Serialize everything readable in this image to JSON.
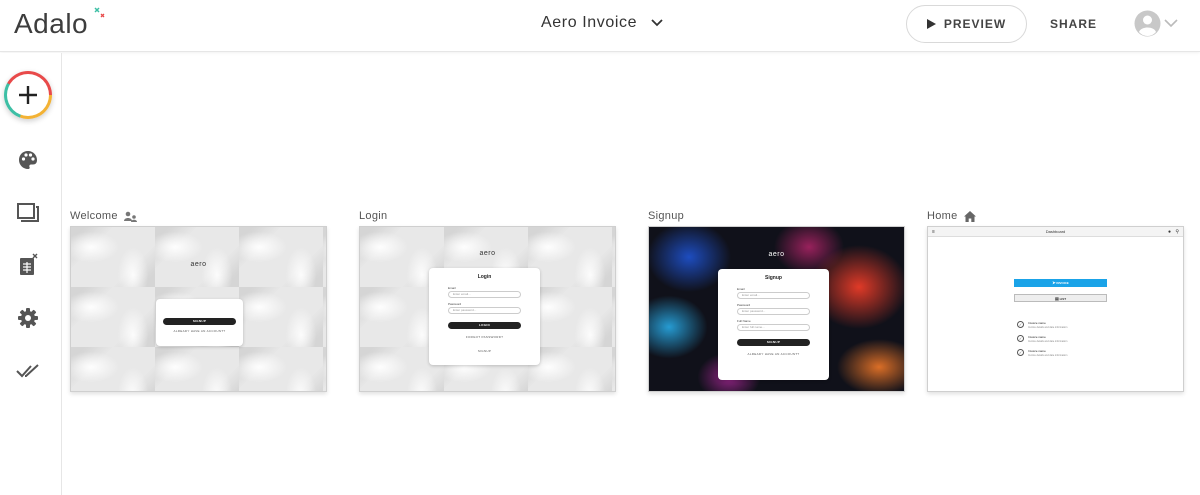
{
  "header": {
    "logo_text": "Adalo",
    "app_name": "Aero Invoice",
    "preview_label": "PREVIEW",
    "share_label": "SHARE"
  },
  "sidebar": {
    "items": [
      {
        "icon": "plus-icon"
      },
      {
        "icon": "palette-icon"
      },
      {
        "icon": "screens-icon"
      },
      {
        "icon": "database-icon"
      },
      {
        "icon": "gear-icon"
      },
      {
        "icon": "double-check-icon"
      }
    ]
  },
  "screens": [
    {
      "label": "Welcome",
      "icon": "users-icon",
      "brand": "aero",
      "signup_button": "SIGNUP",
      "link": "ALREADY HAVE AN ACCOUNT?"
    },
    {
      "label": "Login",
      "brand": "aero",
      "title": "Login",
      "email_label": "Email",
      "email_placeholder": "Enter email...",
      "password_label": "Password",
      "password_placeholder": "Enter password...",
      "button": "LOGIN",
      "forgot_link": "FORGOT PASSWORD?",
      "signup_link": "SIGNUP"
    },
    {
      "label": "Signup",
      "brand": "aero",
      "title": "Signup",
      "email_label": "Email",
      "email_placeholder": "Enter email...",
      "password_label": "Password",
      "password_placeholder": "Enter password...",
      "name_label": "Full Name",
      "name_placeholder": "Enter full name...",
      "button": "SIGNUP",
      "link": "ALREADY HAVE AN ACCOUNT?"
    },
    {
      "label": "Home",
      "icon": "home-icon",
      "title": "Dashboard",
      "button1": "INVOICE",
      "button2": "LIST",
      "items": [
        {
          "title": "Invoice name",
          "subtitle": "Invoice details and date information"
        },
        {
          "title": "Invoice name",
          "subtitle": "Invoice details and date information"
        },
        {
          "title": "Invoice name",
          "subtitle": "Invoice details and date information"
        }
      ]
    }
  ],
  "colors": {
    "accent_blue": "#1aa3e8",
    "text_dark": "#333333",
    "add_ring_red": "#e84a4a",
    "add_ring_yellow": "#f3b234",
    "add_ring_teal": "#3dbfa5"
  }
}
